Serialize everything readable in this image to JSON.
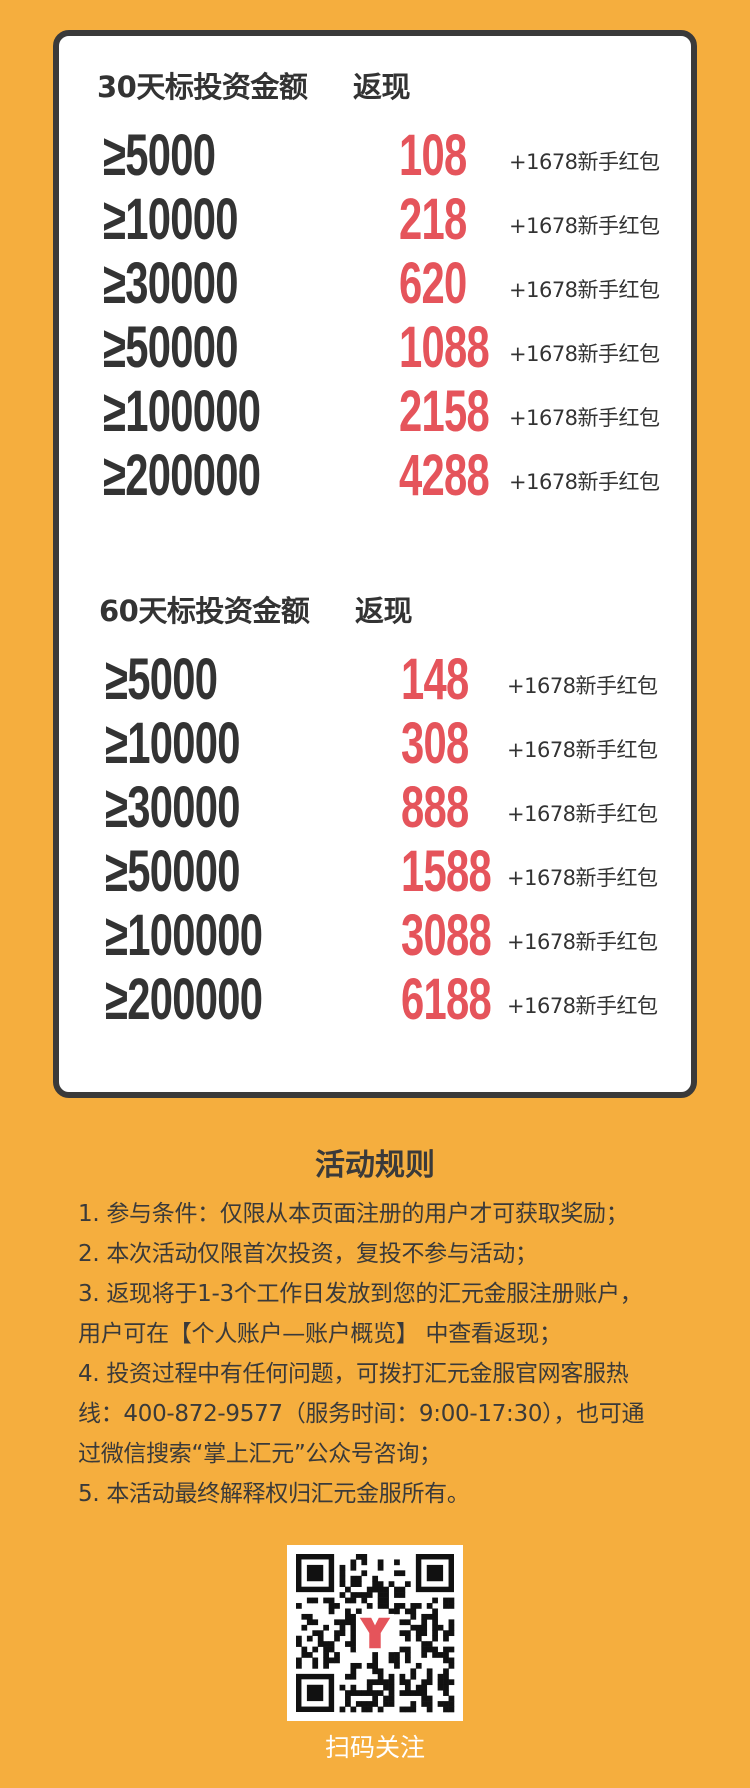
{
  "table30": {
    "header_left": "30天标投资金额",
    "header_right": "返现",
    "rows": [
      {
        "amount": "≥5000",
        "cashback": "108",
        "bonus": "+1678新手红包"
      },
      {
        "amount": "≥10000",
        "cashback": "218",
        "bonus": "+1678新手红包"
      },
      {
        "amount": "≥30000",
        "cashback": "620",
        "bonus": "+1678新手红包"
      },
      {
        "amount": "≥50000",
        "cashback": "1088",
        "bonus": "+1678新手红包"
      },
      {
        "amount": "≥100000",
        "cashback": "2158",
        "bonus": "+1678新手红包"
      },
      {
        "amount": "≥200000",
        "cashback": "4288",
        "bonus": "+1678新手红包"
      }
    ]
  },
  "table60": {
    "header_left": "60天标投资金额",
    "header_right": "返现",
    "rows": [
      {
        "amount": "≥5000",
        "cashback": "148",
        "bonus": "+1678新手红包"
      },
      {
        "amount": "≥10000",
        "cashback": "308",
        "bonus": "+1678新手红包"
      },
      {
        "amount": "≥30000",
        "cashback": "888",
        "bonus": "+1678新手红包"
      },
      {
        "amount": "≥50000",
        "cashback": "1588",
        "bonus": "+1678新手红包"
      },
      {
        "amount": "≥100000",
        "cashback": "3088",
        "bonus": "+1678新手红包"
      },
      {
        "amount": "≥200000",
        "cashback": "6188",
        "bonus": "+1678新手红包"
      }
    ]
  },
  "rules": {
    "title": "活动规则",
    "lines": [
      "1. 参与条件：仅限从本页面注册的用户才可获取奖励；",
      "2. 本次活动仅限首次投资，复投不参与活动；",
      "3. 返现将于1-3个工作日发放到您的汇元金服注册账户，",
      "用户可在【个人账户—账户概览】 中查看返现；",
      "4. 投资过程中有任何问题，可拨打汇元金服官网客服热",
      "线：400-872-9577（服务时间：9:00-17:30），也可通",
      "过微信搜索“掌上汇元”公众号咨询；",
      "5. 本活动最终解释权归汇元金服所有。"
    ]
  },
  "qr": {
    "caption": "扫码关注",
    "icon": "qr-code-icon",
    "logo_color": "#E5545B"
  },
  "colors": {
    "background": "#F5AE3E",
    "accent_red": "#E5545B",
    "text_dark": "#333333"
  }
}
